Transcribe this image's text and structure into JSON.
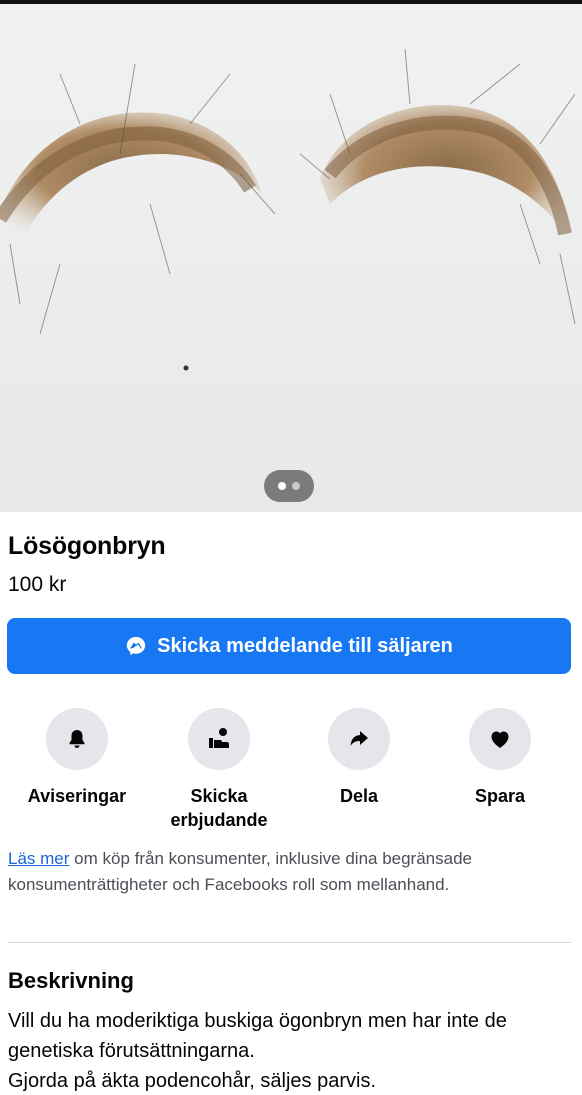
{
  "listing": {
    "title": "Lösögonbryn",
    "price": "100 kr",
    "photo_page": 1,
    "photo_count": 2
  },
  "message_button": {
    "label": "Skicka meddelande till säljaren",
    "icon": "messenger-icon"
  },
  "actions": [
    {
      "label": "Aviseringar",
      "icon": "bell-icon"
    },
    {
      "label": "Skicka erbjudande",
      "icon": "offer-icon"
    },
    {
      "label": "Dela",
      "icon": "share-arrow-icon"
    },
    {
      "label": "Spara",
      "icon": "heart-icon"
    }
  ],
  "consumer_info": {
    "link_text": "Läs mer",
    "text": " om köp från konsumenter, inklusive dina begränsade konsumenträttigheter och Facebooks roll som mellanhand."
  },
  "description": {
    "heading": "Beskrivning",
    "lines": [
      "Vill du ha moderiktiga buskiga ögonbryn men har inte de genetiska förutsättningarna.",
      "Gjorda på äkta podencohår, säljes parvis."
    ]
  },
  "colors": {
    "accent": "#1877f2",
    "icon_bg": "#e4e6eb",
    "link": "#1a66d6"
  }
}
